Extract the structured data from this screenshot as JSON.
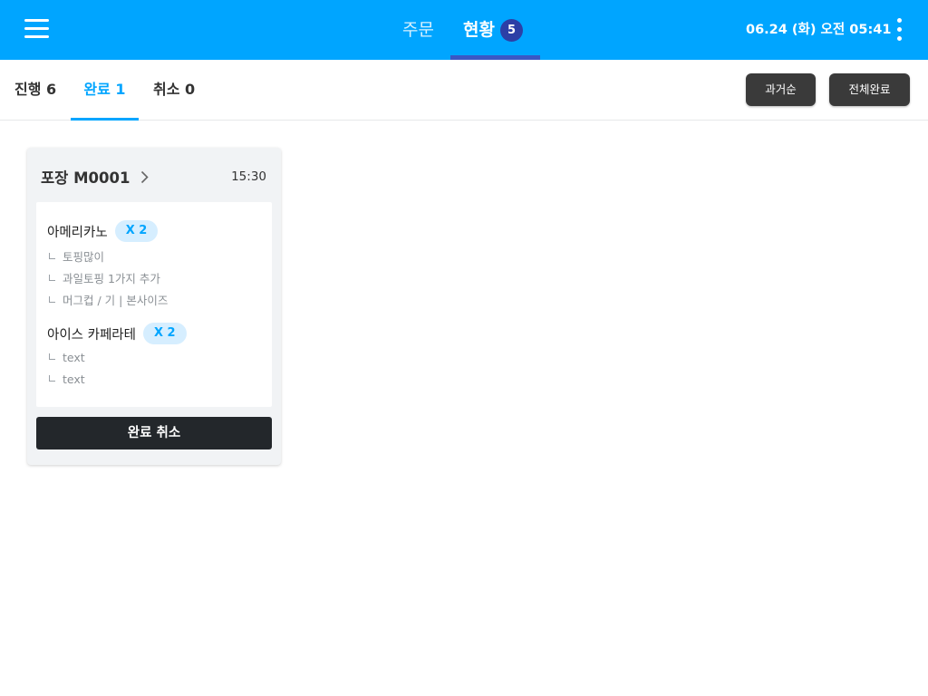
{
  "header": {
    "tabs": [
      {
        "label": "주문"
      },
      {
        "label": "현황",
        "badge": "5"
      }
    ],
    "datetime": "06.24 (화) 오전 05:41",
    "accent_color": "#00a5ff"
  },
  "subtabs": [
    {
      "label": "진행 6"
    },
    {
      "label": "완료 1"
    },
    {
      "label": "취소 0"
    }
  ],
  "actions": {
    "sort_label": "과거순",
    "complete_all_label": "전체완료"
  },
  "card": {
    "title": "포장 M0001",
    "time": "15:30",
    "items": [
      {
        "name": "아메리카노",
        "qty": "X 2",
        "options": [
          "토핑많이",
          "과일토핑 1가지 추가",
          "머그컵 / 기 | 본사이즈"
        ]
      },
      {
        "name": "아이스 카페라테",
        "qty": "X 2",
        "options": [
          "text",
          "text"
        ]
      }
    ],
    "cancel_label": "완료 취소"
  }
}
